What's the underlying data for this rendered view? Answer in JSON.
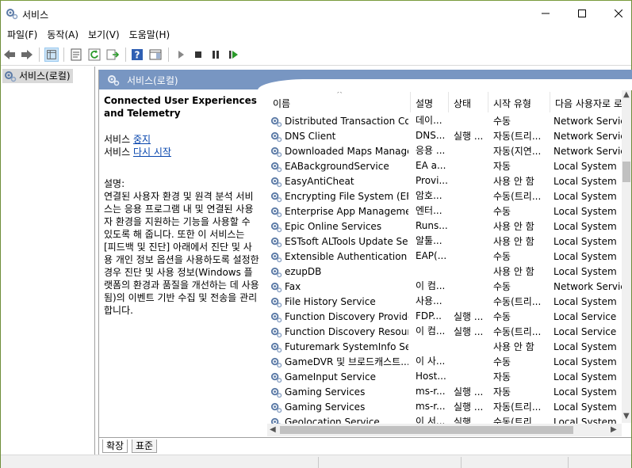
{
  "window": {
    "title": "서비스"
  },
  "menu": [
    "파일(F)",
    "동작(A)",
    "보기(V)",
    "도움말(H)"
  ],
  "tree": {
    "root": "서비스(로컬)"
  },
  "panel": {
    "header": "서비스(로컬)"
  },
  "details": {
    "service_title": "Connected User Experiences and Telemetry",
    "action1_prefix": "서비스 ",
    "action1_link": "중지",
    "action2_prefix": "서비스 ",
    "action2_link": "다시 시작",
    "desc_label": "설명:",
    "desc_text": "연결된 사용자 환경 및 원격 분석 서비스는 응용 프로그램 내 및 연결된 사용자 환경을 지원하는 기능을 사용할 수 있도록 해 줍니다. 또한 이 서비스는 [피드백 및 진단] 아래에서 진단 및 사용 개인 정보 옵션을 사용하도록 설정한 경우 진단 및 사용 정보(Windows 플랫폼의 환경과 품질을 개선하는 데 사용됨)의 이벤트 기반 수집 및 전송을 관리합니다."
  },
  "columns": {
    "name": "이름",
    "description": "설명",
    "status": "상태",
    "startup": "시작 유형",
    "logon": "다음 사용자로 로"
  },
  "services": [
    {
      "name": "Distributed Transaction Co...",
      "desc": "데이...",
      "status": "",
      "startup": "수동",
      "logon": "Network Service"
    },
    {
      "name": "DNS Client",
      "desc": "DNS...",
      "status": "실행 ...",
      "startup": "자동(트리...",
      "logon": "Network Service"
    },
    {
      "name": "Downloaded Maps Manager",
      "desc": "응용 ...",
      "status": "",
      "startup": "자동(지연...",
      "logon": "Network Service"
    },
    {
      "name": "EABackgroundService",
      "desc": "EA a...",
      "status": "",
      "startup": "자동",
      "logon": "Local System"
    },
    {
      "name": "EasyAntiCheat",
      "desc": "Provi...",
      "status": "",
      "startup": "사용 안 함",
      "logon": "Local System"
    },
    {
      "name": "Encrypting File System (EFS)",
      "desc": "암호...",
      "status": "",
      "startup": "수동(트리...",
      "logon": "Local System"
    },
    {
      "name": "Enterprise App Manageme...",
      "desc": "엔터...",
      "status": "",
      "startup": "수동",
      "logon": "Local System"
    },
    {
      "name": "Epic Online Services",
      "desc": "Runs...",
      "status": "",
      "startup": "사용 안 함",
      "logon": "Local System"
    },
    {
      "name": "ESTsoft ALTools Update Se...",
      "desc": "알툴...",
      "status": "",
      "startup": "사용 안 함",
      "logon": "Local System"
    },
    {
      "name": "Extensible Authentication P...",
      "desc": "EAP(...",
      "status": "",
      "startup": "수동",
      "logon": "Local System"
    },
    {
      "name": "ezupDB",
      "desc": "",
      "status": "",
      "startup": "사용 안 함",
      "logon": "Local System"
    },
    {
      "name": "Fax",
      "desc": "이 컴...",
      "status": "",
      "startup": "수동",
      "logon": "Network Service"
    },
    {
      "name": "File History Service",
      "desc": "사용...",
      "status": "",
      "startup": "수동(트리...",
      "logon": "Local System"
    },
    {
      "name": "Function Discovery Provide...",
      "desc": "FDP...",
      "status": "실행 ...",
      "startup": "수동",
      "logon": "Local Service"
    },
    {
      "name": "Function Discovery Resour...",
      "desc": "이 컴...",
      "status": "실행 ...",
      "startup": "수동(트리...",
      "logon": "Local Service"
    },
    {
      "name": "Futuremark SystemInfo Ser...",
      "desc": "",
      "status": "",
      "startup": "사용 안 함",
      "logon": "Local System"
    },
    {
      "name": "GameDVR 및 브로드캐스트...",
      "desc": "이 사...",
      "status": "",
      "startup": "수동",
      "logon": "Local System"
    },
    {
      "name": "GameInput Service",
      "desc": "Host...",
      "status": "",
      "startup": "자동",
      "logon": "Local System"
    },
    {
      "name": "Gaming Services",
      "desc": "ms-r...",
      "status": "실행 ...",
      "startup": "자동",
      "logon": "Local System"
    },
    {
      "name": "Gaming Services",
      "desc": "ms-r...",
      "status": "실행 ...",
      "startup": "자동(트리...",
      "logon": "Local System"
    },
    {
      "name": "Geolocation Service",
      "desc": "이 서...",
      "status": "실행 ...",
      "startup": "수동(트리...",
      "logon": "Local System"
    }
  ],
  "tabs": {
    "extended": "확장",
    "standard": "표준"
  },
  "colors": {
    "panel_header": "#7896c2",
    "link": "#0645ad"
  }
}
